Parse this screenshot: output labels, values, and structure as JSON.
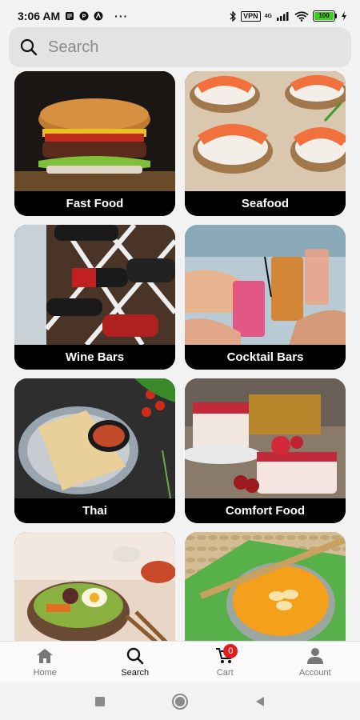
{
  "status": {
    "time": "3:06 AM",
    "dots": "···",
    "vpn": "VPN",
    "network": "4G",
    "battery": "100"
  },
  "search": {
    "placeholder": "Search"
  },
  "categories": [
    {
      "label": "Fast Food"
    },
    {
      "label": "Seafood"
    },
    {
      "label": "Wine Bars"
    },
    {
      "label": "Cocktail Bars"
    },
    {
      "label": "Thai"
    },
    {
      "label": "Comfort Food"
    },
    {
      "label": ""
    },
    {
      "label": ""
    }
  ],
  "nav": {
    "home": "Home",
    "search": "Search",
    "cart": "Cart",
    "cart_count": "0",
    "account": "Account"
  },
  "colors": {
    "accent": "#111111",
    "badge": "#e21b1b",
    "battery": "#3ccf1f"
  }
}
